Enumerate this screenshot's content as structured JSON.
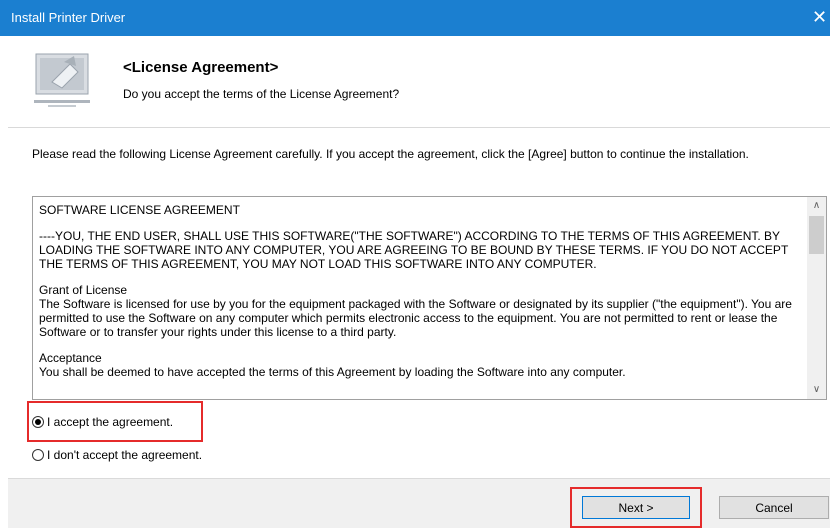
{
  "window": {
    "title": "Install Printer Driver",
    "close_glyph": "✕"
  },
  "header": {
    "title": "<License Agreement>",
    "subtitle": "Do you accept the terms of the License Agreement?",
    "icon": "computer-setup-icon"
  },
  "intro": "Please read the following License Agreement carefully. If you accept the agreement, click the [Agree] button to continue the installation.",
  "license": {
    "heading": "SOFTWARE LICENSE AGREEMENT",
    "para1": "----YOU, THE END USER, SHALL USE THIS SOFTWARE(\"THE SOFTWARE\") ACCORDING TO THE TERMS OF THIS AGREEMENT. BY LOADING THE SOFTWARE INTO ANY COMPUTER, YOU ARE AGREEING TO BE BOUND BY THESE TERMS. IF YOU DO NOT ACCEPT THE TERMS OF THIS AGREEMENT, YOU MAY NOT LOAD THIS SOFTWARE INTO ANY COMPUTER.",
    "grant_title": "Grant of License",
    "grant_text": "The Software is licensed for use by you for the equipment packaged with the Software or designated by its supplier (\"the equipment\"). You are permitted to use the Software on any computer which permits electronic access to the equipment. You are not permitted to rent or lease the Software or to transfer your rights under this license to a third party.",
    "acceptance_title": "Acceptance",
    "acceptance_partial": "You shall be deemed to have accepted the terms of this Agreement by loading the Software into any computer."
  },
  "options": {
    "accept": {
      "label": "I accept the agreement.",
      "checked": true
    },
    "decline": {
      "label": "I don't accept the agreement.",
      "checked": false
    }
  },
  "buttons": {
    "next": "Next >",
    "cancel": "Cancel"
  },
  "colors": {
    "titlebar": "#1b7fd0",
    "highlight": "#e52b2b"
  }
}
